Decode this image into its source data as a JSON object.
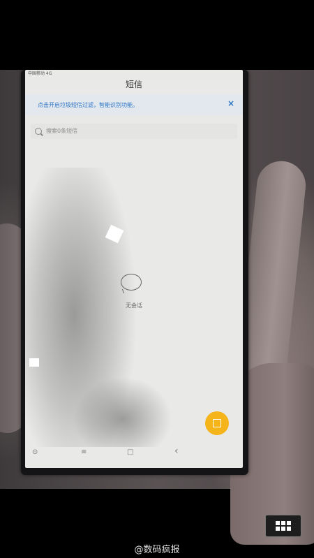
{
  "status_bar": {
    "left": "中国移动 4G"
  },
  "app": {
    "title": "短信"
  },
  "banner": {
    "text": "点击开启垃圾短信过滤，智能识别功能。",
    "close": "×"
  },
  "search": {
    "placeholder": "搜索0条短信"
  },
  "empty_state": {
    "icon": "message-bubble-icon",
    "label": "无会话"
  },
  "compose": {
    "icon": "compose-icon",
    "color": "#f4b41a"
  },
  "nav": {
    "items": [
      {
        "icon": "settings-icon",
        "glyph": "⊙"
      },
      {
        "icon": "menu-icon",
        "glyph": "≡"
      },
      {
        "icon": "home-icon",
        "glyph": "□"
      },
      {
        "icon": "back-icon",
        "glyph": "‹"
      }
    ]
  },
  "watermark": {
    "text": "@数码疯报"
  }
}
